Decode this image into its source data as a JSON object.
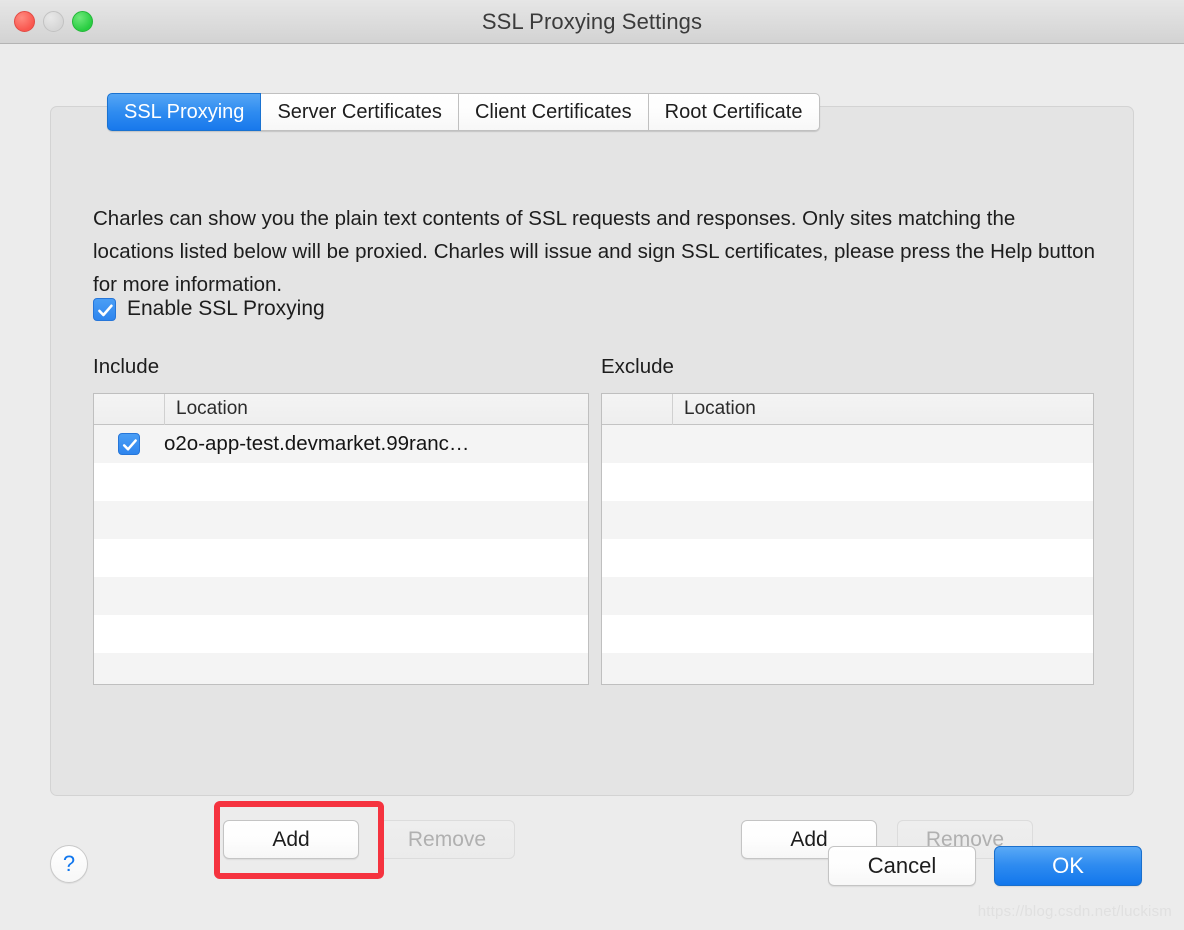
{
  "window": {
    "title": "SSL Proxying Settings",
    "traffic_lights": [
      {
        "name": "close",
        "color": "#f9574f",
        "enabled": true
      },
      {
        "name": "minimize",
        "color": "#d6d6d6",
        "enabled": false
      },
      {
        "name": "maximize",
        "color": "#28cd41",
        "enabled": true
      }
    ]
  },
  "tabs": [
    {
      "label": "SSL Proxying",
      "active": true
    },
    {
      "label": "Server Certificates",
      "active": false
    },
    {
      "label": "Client Certificates",
      "active": false
    },
    {
      "label": "Root Certificate",
      "active": false
    }
  ],
  "panel": {
    "description": "Charles can show you the plain text contents of SSL requests and responses. Only sites matching the locations listed below will be proxied. Charles will issue and sign SSL certificates, please press the Help button for more information.",
    "enable_checkbox": {
      "label": "Enable SSL Proxying",
      "checked": true,
      "checkmark_icon": "check-icon",
      "accent_color": "#2e85ee"
    }
  },
  "include": {
    "heading": "Include",
    "column_header": "Location",
    "rows": [
      {
        "checked": true,
        "location": "o2o-app-test.devmarket.99ranc…"
      }
    ],
    "empty_row_count": 6,
    "add_label": "Add",
    "remove_label": "Remove",
    "remove_disabled": true,
    "add_highlighted": true,
    "highlight_color": "#f5333f"
  },
  "exclude": {
    "heading": "Exclude",
    "column_header": "Location",
    "rows": [],
    "empty_row_count": 7,
    "add_label": "Add",
    "remove_label": "Remove",
    "remove_disabled": true
  },
  "footer": {
    "help_label": "?",
    "help_icon": "question-mark-icon",
    "cancel_label": "Cancel",
    "ok_label": "OK",
    "ok_accent": "#1277ec"
  },
  "watermark": "https://blog.csdn.net/luckism"
}
